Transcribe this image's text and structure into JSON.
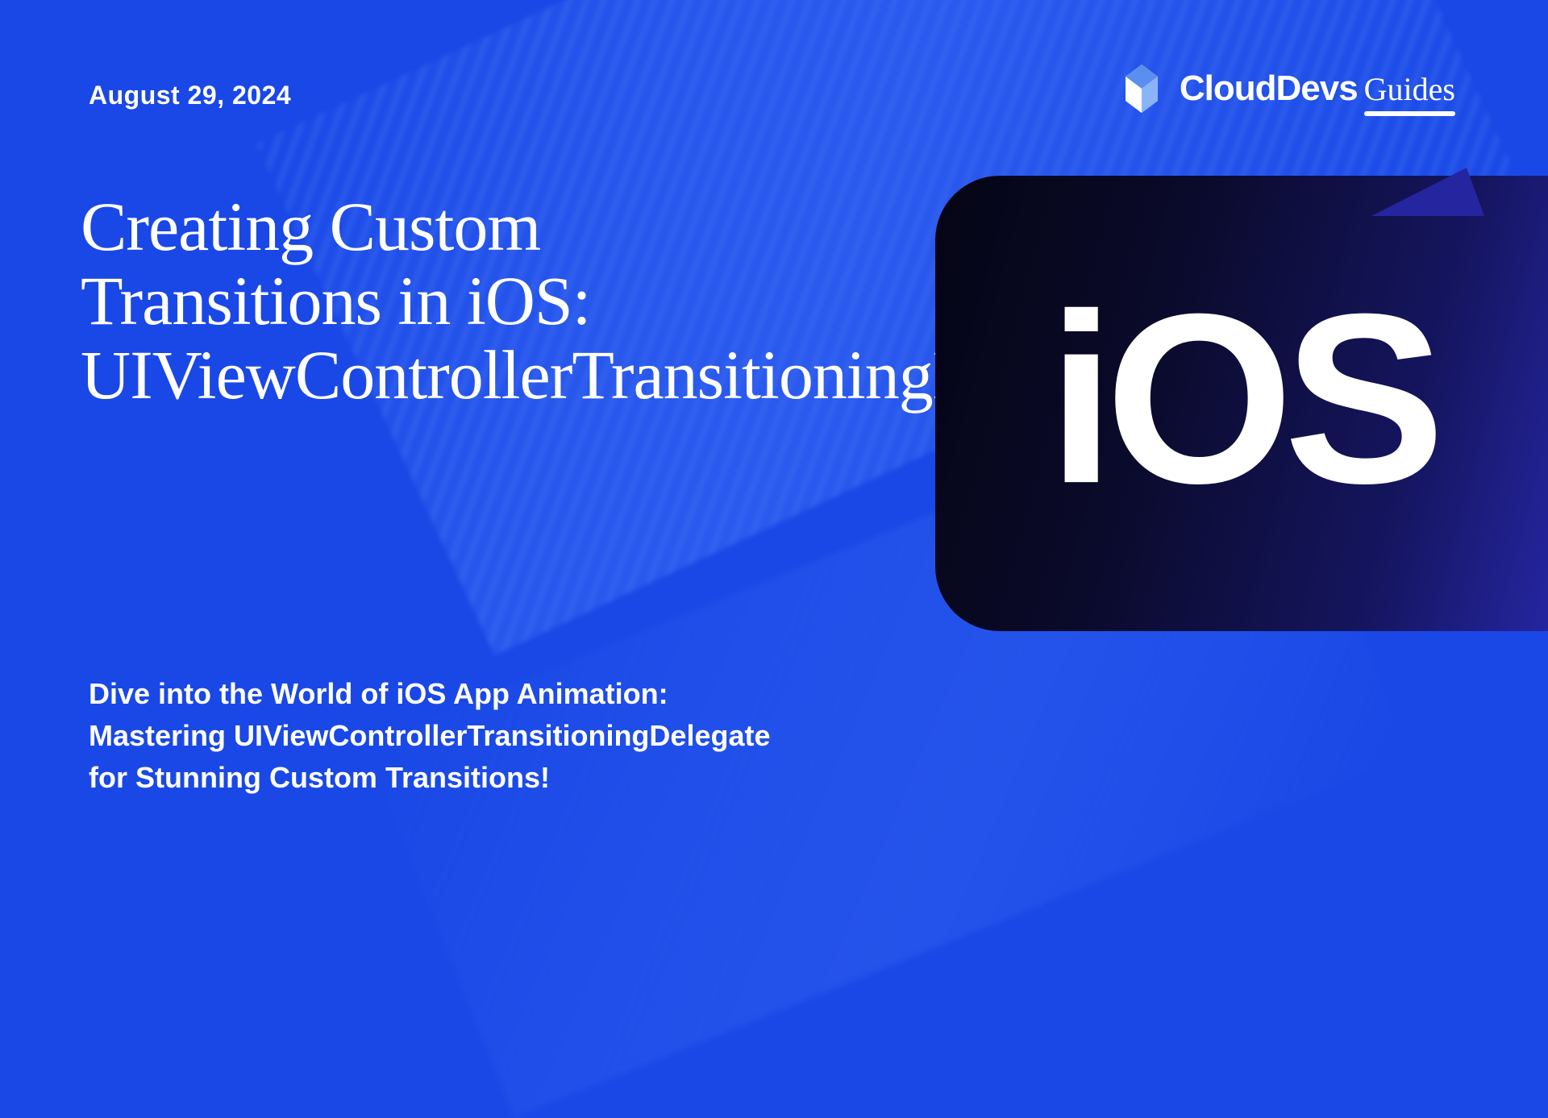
{
  "date": "August 29, 2024",
  "logo": {
    "brand": "CloudDevs",
    "suffix": "Guides"
  },
  "title": "Creating Custom Transitions in iOS: UIViewControllerTransitioningDelegate",
  "subtitle": "Dive into the World of iOS App Animation: Mastering UIViewControllerTransitioningDelegate for Stunning Custom Transitions!",
  "badge_text": "iOS"
}
